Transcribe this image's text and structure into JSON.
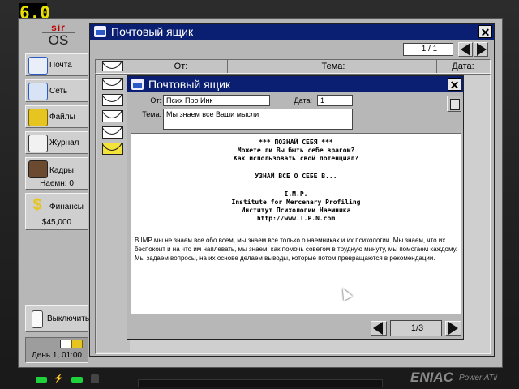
{
  "hud": {
    "fps": "6.0"
  },
  "logo": {
    "top": "sir",
    "bottom": "OS"
  },
  "sidebar": {
    "items": [
      {
        "label": "Почта",
        "icon": "mail-icon"
      },
      {
        "label": "Сеть",
        "icon": "network-icon"
      },
      {
        "label": "Файлы",
        "icon": "folder-icon"
      },
      {
        "label": "Журнал",
        "icon": "book-icon"
      },
      {
        "label": "Кадры",
        "sub": "Наемн: 0",
        "icon": "portrait-icon"
      },
      {
        "label": "Финансы",
        "sub": "$45,000",
        "icon": "dollar-icon"
      }
    ],
    "shutdown": "Выключить",
    "clock": "День 1, 01:00"
  },
  "mailbox": {
    "title": "Почтовый ящик",
    "page": "1 / 1",
    "columns": [
      "",
      "От:",
      "Тема:",
      "Дата:"
    ],
    "rows": [
      {
        "read": true
      },
      {
        "read": true
      },
      {
        "read": true
      },
      {
        "read": true
      },
      {
        "read": false
      }
    ]
  },
  "message": {
    "title": "Почтовый ящик",
    "from_label": "От:",
    "from": "Псих Про Инк",
    "date_label": "Дата:",
    "date": "1",
    "subject_label": "Тема:",
    "subject": "Мы знаем все Ваши мысли",
    "body_lines": [
      "*** ПОЗНАЙ СЕБЯ ***",
      "Можете ли Вы быть себе врагом?",
      "Как использовать свой потенциал?",
      "",
      "УЗНАЙ ВСЕ О СЕБЕ В...",
      "",
      "I.M.P.",
      "Institute for Mercenary Profiling",
      "Институт Психологии Наемника",
      "http://www.I.P.N.com"
    ],
    "paragraph": "В IMP мы не знаем  все обо всем, мы знаем все только о наемниках и их психологии. Мы знаем, что их беспокоит и на что им наплевать, мы знаем, как помочь советом в трудную минуту, мы помогаем каждому. Мы задаем вопросы, на их основе делаем выводы, которые потом превращаются в рекомендации.",
    "page": "1/3"
  },
  "footer": {
    "brand": "ENIAC",
    "model": "Power ATii"
  },
  "colors": {
    "titlebar": "#0a1f72",
    "fps": "#e8e000",
    "panel": "#b7b7b7"
  }
}
